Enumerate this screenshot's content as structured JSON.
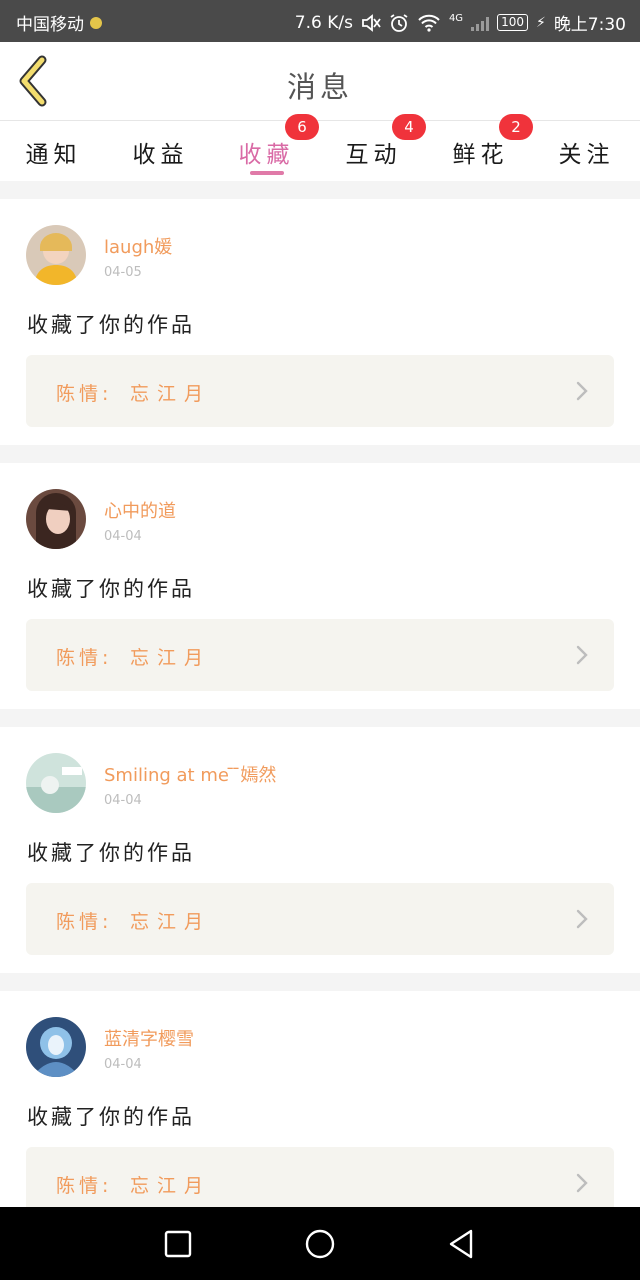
{
  "status_bar": {
    "carrier": "中国移动",
    "speed": "7.6 K/s",
    "network": "4G",
    "battery": "100",
    "time": "晚上7:30"
  },
  "header": {
    "title": "消息",
    "back_icon": "chevron-left-icon"
  },
  "tabs": [
    {
      "label": "通知",
      "badge": null
    },
    {
      "label": "收益",
      "badge": null
    },
    {
      "label": "收藏",
      "badge": "6",
      "active": true
    },
    {
      "label": "互动",
      "badge": "4"
    },
    {
      "label": "鲜花",
      "badge": "2"
    },
    {
      "label": "关注",
      "badge": null
    }
  ],
  "messages": [
    {
      "user": "laugh媛",
      "date": "04-05",
      "action": "收藏了你的作品",
      "work_label": "陈情:",
      "work_title": "忘江月"
    },
    {
      "user": "心中的道",
      "date": "04-04",
      "action": "收藏了你的作品",
      "work_label": "陈情:",
      "work_title": "忘江月"
    },
    {
      "user": "Smiling at me  ̄ ̄嫣然",
      "date": "04-04",
      "action": "收藏了你的作品",
      "work_label": "陈情:",
      "work_title": "忘江月"
    },
    {
      "user": "蓝清字樱雪",
      "date": "04-04",
      "action": "收藏了你的作品",
      "work_label": "陈情:",
      "work_title": "忘江月"
    }
  ],
  "colors": {
    "accent_pink": "#d96aa5",
    "badge_red": "#f0333b",
    "username_orange": "#f19b5c",
    "work_box_bg": "#f5f4ef"
  },
  "nav_icons": [
    "square-icon",
    "circle-icon",
    "triangle-back-icon"
  ]
}
